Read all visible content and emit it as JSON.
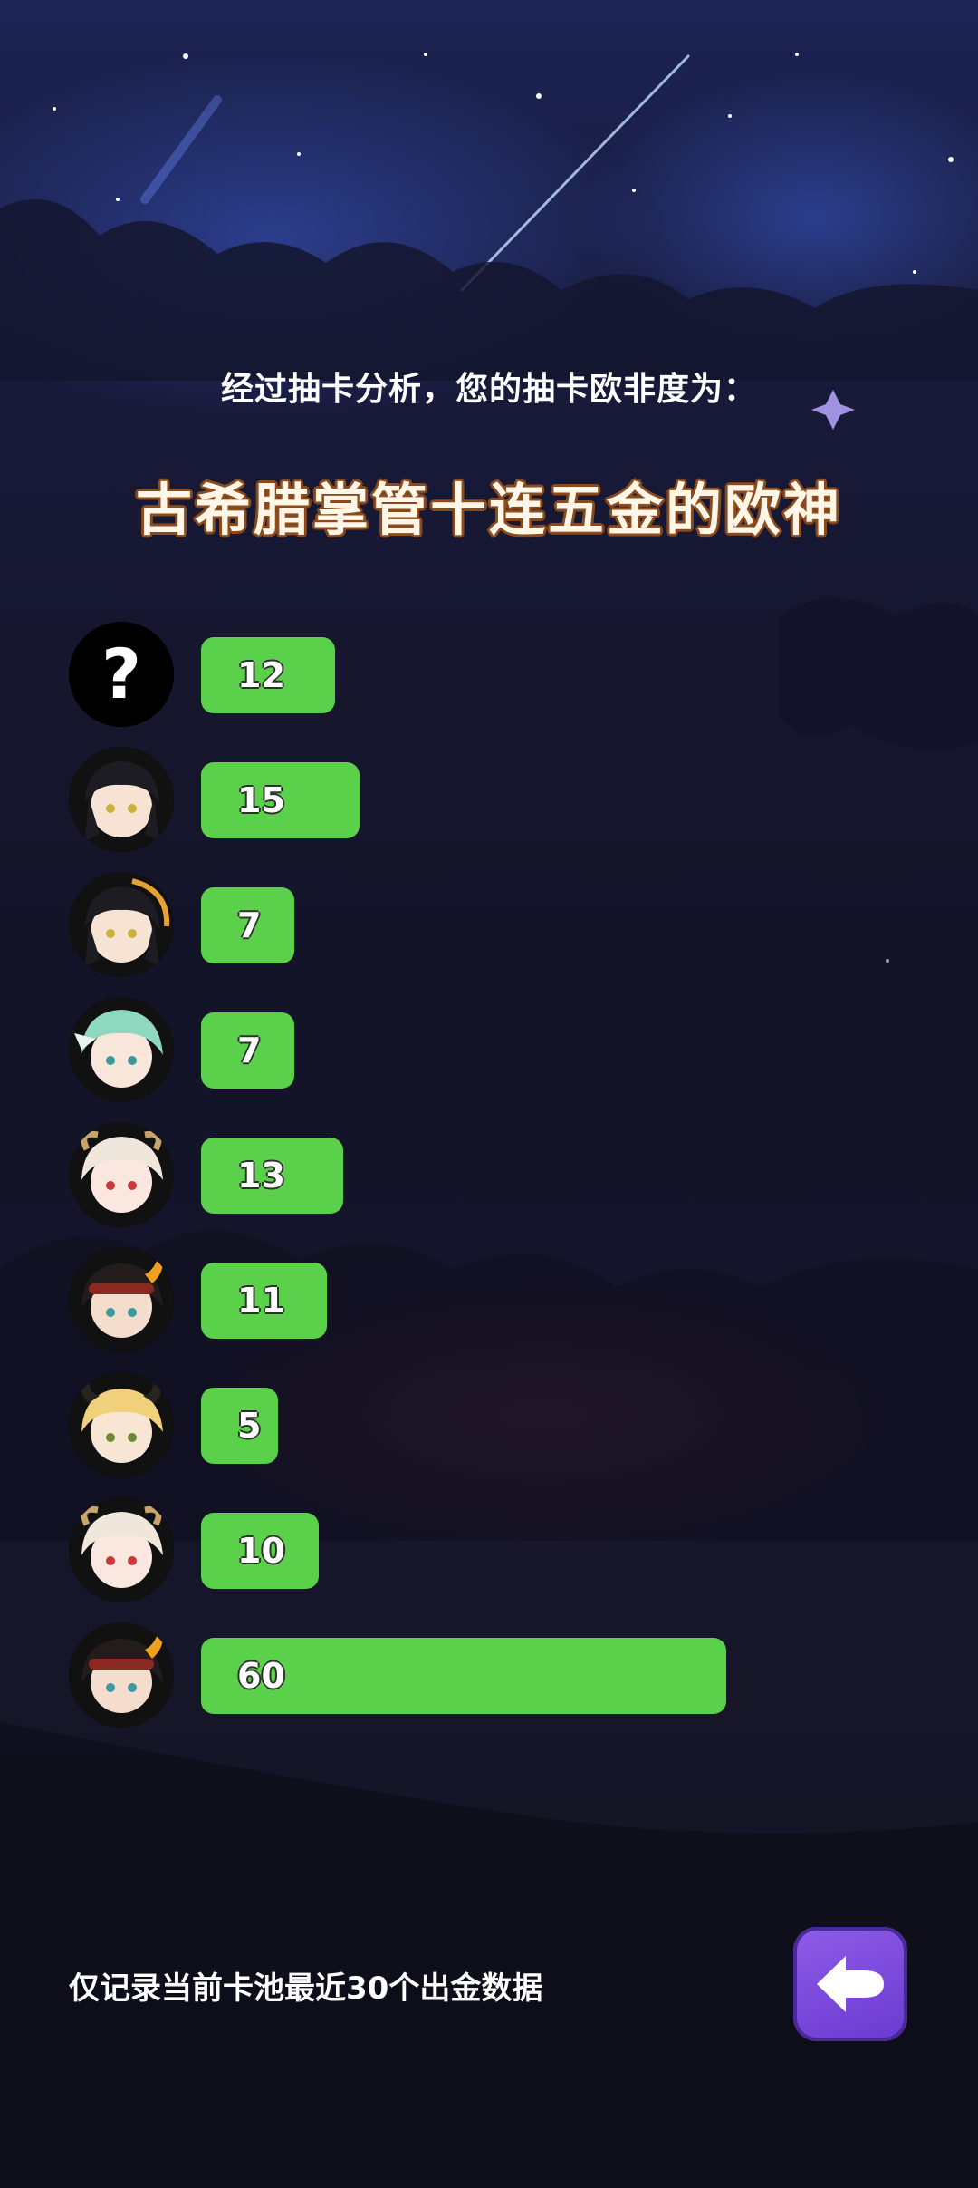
{
  "header": {
    "subtitle": "经过抽卡分析，您的抽卡欧非度为：",
    "title": "古希腊掌管十连五金的欧神"
  },
  "pulls": [
    {
      "avatar": "unknown-question-icon",
      "count": 12,
      "label": "12"
    },
    {
      "avatar": "dark-hair-character-avatar",
      "count": 15,
      "label": "15"
    },
    {
      "avatar": "dark-hair-character-avatar",
      "count": 7,
      "label": "7"
    },
    {
      "avatar": "green-hair-character-avatar",
      "count": 7,
      "label": "7"
    },
    {
      "avatar": "white-hair-horned-character-avatar",
      "count": 13,
      "label": "13"
    },
    {
      "avatar": "flame-crown-character-avatar",
      "count": 11,
      "label": "11"
    },
    {
      "avatar": "blonde-horned-character-avatar",
      "count": 5,
      "label": "5"
    },
    {
      "avatar": "white-hair-horned-character-avatar",
      "count": 10,
      "label": "10"
    },
    {
      "avatar": "flame-crown-character-avatar",
      "count": 60,
      "label": "60"
    }
  ],
  "footer": {
    "note": "仅记录当前卡池最近30个出金数据",
    "back_icon": "back-arrow-icon"
  },
  "colors": {
    "bar": "#5bd04a",
    "title_outline": "#8a4a1c",
    "back_button": "#7a48dc"
  }
}
